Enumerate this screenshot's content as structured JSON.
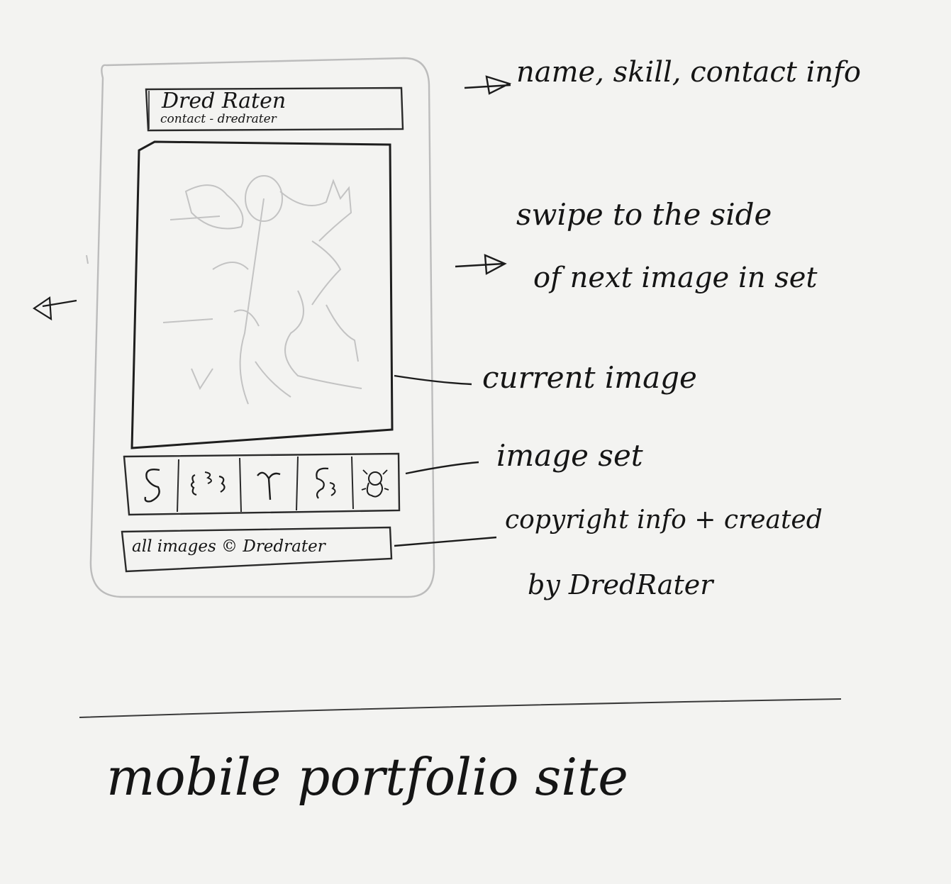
{
  "phone": {
    "header": {
      "name": "Dred Raten",
      "contact": "contact - dredrater"
    },
    "footer": {
      "copyright": "all images © Dredrater"
    }
  },
  "annotations": {
    "header_note": "name, skill, contact info",
    "swipe_note_line1": "swipe to the side",
    "swipe_note_line2": "of next image in set",
    "current_image_note": "current image",
    "image_set_note": "image set",
    "copyright_note_line1": "copyright info + created",
    "copyright_note_line2": "by DredRater"
  },
  "caption": "mobile portfolio site",
  "colors": {
    "paper": "#f3f3f1",
    "ink": "#151515",
    "pencil": "#b9b9b9"
  },
  "icons": {
    "arrow": "arrow-right-icon",
    "left_arrow": "arrow-left-icon",
    "thumbnails": [
      "squiggle-icon",
      "brackets-icon",
      "gamma-icon",
      "scribble-icon",
      "bug-icon"
    ]
  }
}
